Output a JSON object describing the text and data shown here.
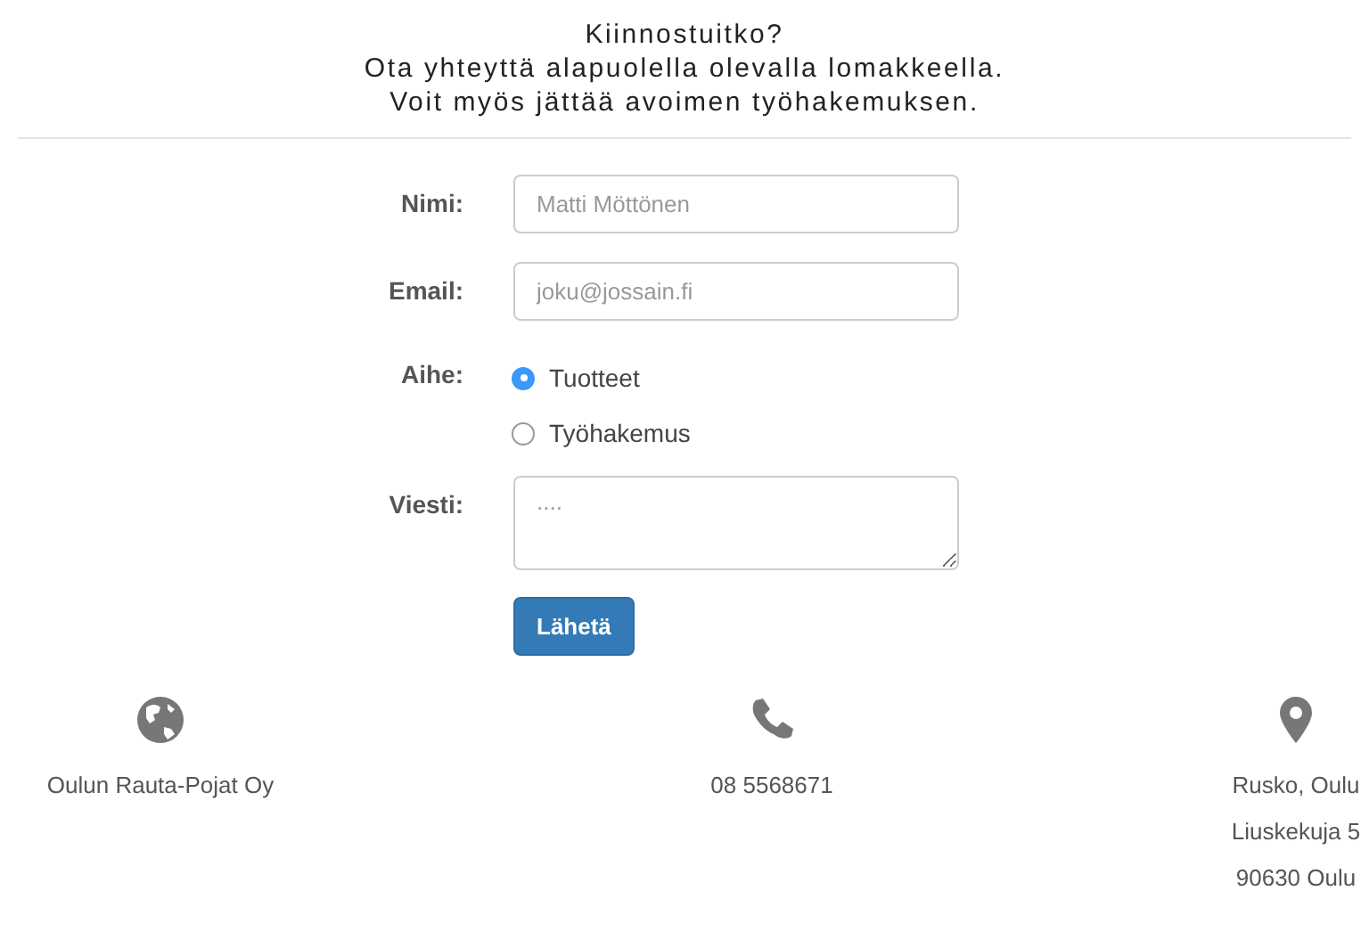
{
  "header": {
    "lines": [
      "Kiinnostuitko?",
      "Ota yhteyttä alapuolella olevalla lomakkeella.",
      "Voit myös jättää avoimen työhakemuksen."
    ]
  },
  "form": {
    "fields": [
      {
        "kind": "text",
        "label": "Nimi:",
        "placeholder": "Matti Möttönen"
      },
      {
        "kind": "text",
        "label": "Email:",
        "placeholder": "joku@jossain.fi"
      },
      {
        "kind": "radio",
        "label": "Aihe:",
        "options": [
          {
            "label": "Tuotteet",
            "selected": true
          },
          {
            "label": "Työhakemus",
            "selected": false
          }
        ]
      },
      {
        "kind": "textarea",
        "label": "Viesti:",
        "placeholder": "...."
      }
    ],
    "submit": "Lähetä"
  },
  "footer": [
    {
      "kind": "company",
      "lines": [
        "Oulun Rauta-Pojat Oy"
      ]
    },
    {
      "kind": "phone",
      "lines": [
        "08 5568671"
      ]
    },
    {
      "kind": "address",
      "lines": [
        "Rusko, Oulu",
        "Liuskekuja 5",
        "90630 Oulu"
      ]
    }
  ]
}
